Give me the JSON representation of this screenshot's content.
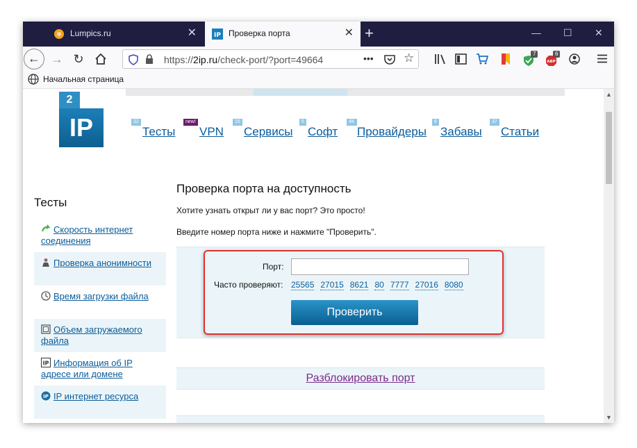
{
  "browser": {
    "tabs": [
      {
        "title": "Lumpics.ru",
        "active": false
      },
      {
        "title": "Проверка порта",
        "active": true
      }
    ],
    "close_glyph": "✕",
    "new_tab_glyph": "+",
    "window_controls": {
      "minimize": "—",
      "maximize": "☐",
      "close": "✕"
    },
    "url_prefix": "https://",
    "url_host": "2ip.ru",
    "url_path": "/check-port/?port=49664",
    "bookmark": "Начальная страница",
    "extension_badges": {
      "shield": "7",
      "abp": "6"
    },
    "accent": "#1f1d40"
  },
  "site": {
    "logo_small": "2",
    "logo_big": "IP",
    "menu": [
      {
        "label": "Тесты",
        "badge": "32"
      },
      {
        "label": "VPN",
        "badge": "new!"
      },
      {
        "label": "Сервисы",
        "badge": "15"
      },
      {
        "label": "Софт",
        "badge": "5"
      },
      {
        "label": "Провайдеры",
        "badge": "4K"
      },
      {
        "label": "Забавы",
        "badge": "6"
      },
      {
        "label": "Статьи",
        "badge": "37"
      }
    ],
    "sidebar": {
      "title": "Тесты",
      "items": [
        {
          "label": "Скорость интернет соединения"
        },
        {
          "label": "Проверка анонимности"
        },
        {
          "label": "Время загрузки файла"
        },
        {
          "label": "Объем загружаемого файла"
        },
        {
          "label": "Информация об IP адресе или домене"
        },
        {
          "label": "IP интернет ресурса"
        }
      ]
    },
    "main": {
      "heading": "Проверка порта на доступность",
      "intro": "Хотите узнать открыт ли у вас порт? Это просто!",
      "instruction": "Введите номер порта ниже и нажмите \"Проверить\".",
      "port_label": "Порт:",
      "port_value": "",
      "frequent_label": "Часто проверяют:",
      "frequent_ports": [
        "25565",
        "27015",
        "8621",
        "80",
        "7777",
        "27016",
        "8080"
      ],
      "check_button": "Проверить",
      "unblock_link": "Разблокировать порт"
    }
  }
}
